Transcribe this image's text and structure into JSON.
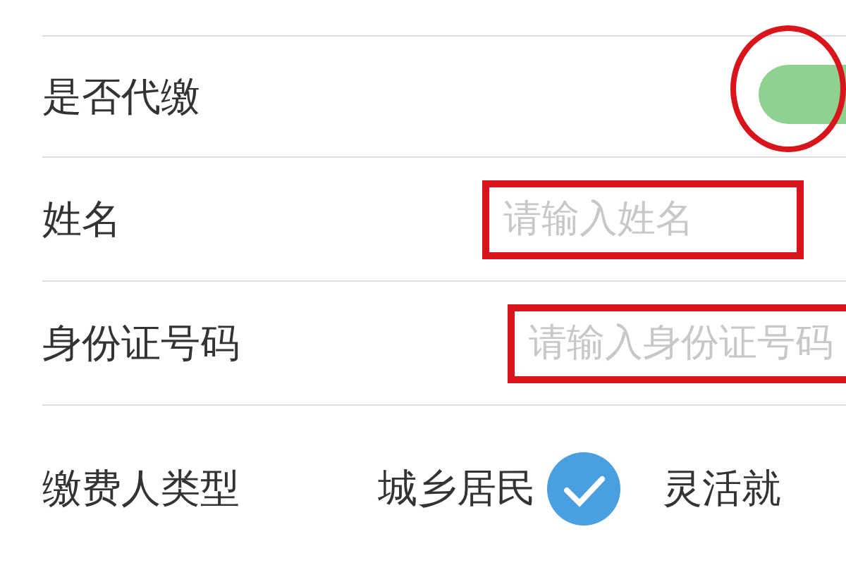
{
  "form": {
    "rows": [
      {
        "kind": "toggle",
        "label": "是否代缴",
        "on": true
      },
      {
        "kind": "input",
        "label": "姓名",
        "placeholder": "请输入姓名"
      },
      {
        "kind": "input",
        "label": "身份证号码",
        "placeholder": "请输入身份证号码"
      },
      {
        "kind": "choice",
        "label": "缴费人类型",
        "options": [
          {
            "label": "城乡居民",
            "selected": true
          },
          {
            "label": "灵活就",
            "selected": false
          }
        ]
      }
    ]
  }
}
